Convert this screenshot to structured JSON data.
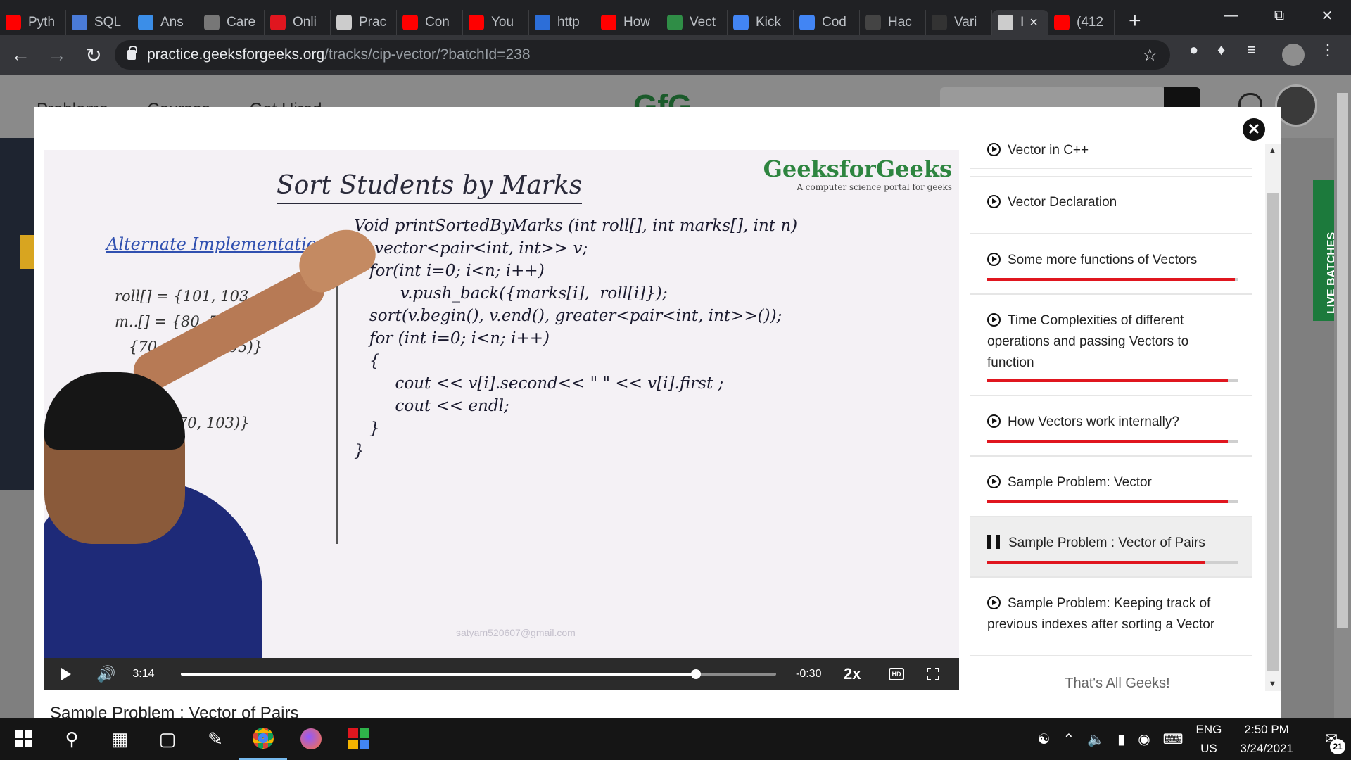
{
  "browser": {
    "tabs": [
      {
        "label": "Pyth",
        "icon": "youtube-icon",
        "color": "#ff0000"
      },
      {
        "label": "SQL",
        "icon": "doc-icon",
        "color": "#4a7bd8"
      },
      {
        "label": "Ans",
        "icon": "brainly-icon",
        "color": "#3b8ee8"
      },
      {
        "label": "Care",
        "icon": "ampersand-icon",
        "color": "#777777"
      },
      {
        "label": "Onli",
        "icon": "u-icon",
        "color": "#e0161f"
      },
      {
        "label": "Prac",
        "icon": "globe-icon",
        "color": "#cccccc"
      },
      {
        "label": "Con",
        "icon": "youtube-icon",
        "color": "#ff0000"
      },
      {
        "label": "You",
        "icon": "youtube-icon",
        "color": "#ff0000"
      },
      {
        "label": "http",
        "icon": "video-icon",
        "color": "#2c6ed8"
      },
      {
        "label": "How",
        "icon": "youtube-icon",
        "color": "#ff0000"
      },
      {
        "label": "Vect",
        "icon": "gfg-icon",
        "color": "#2f8d46"
      },
      {
        "label": "Kick",
        "icon": "google-icon",
        "color": "#4285f4"
      },
      {
        "label": "Cod",
        "icon": "google-icon",
        "color": "#4285f4"
      },
      {
        "label": "Hac",
        "icon": "github-icon",
        "color": "#444444"
      },
      {
        "label": "Vari",
        "icon": "hh-icon",
        "color": "#333333"
      },
      {
        "label": "I",
        "icon": "globe-icon",
        "color": "#cccccc",
        "active": true
      },
      {
        "label": "(412",
        "icon": "youtube-icon",
        "color": "#ff0000"
      }
    ],
    "new_tab": "+",
    "url_host": "practice.geeksforgeeks.org",
    "url_path": "/tracks/cip-vector/?batchId=238"
  },
  "site": {
    "nav": [
      "Problems",
      "Courses",
      "Get Hired"
    ],
    "logo": "GfG",
    "live_batches": "LIVE BATCHES"
  },
  "video": {
    "whiteboard": {
      "title": "Sort Students by Marks",
      "brand": "GeeksforGeeks",
      "brand_tag": "A computer science portal for geeks",
      "alt_heading": "Alternate Implementation",
      "code": "Void printSortedByMarks (int roll[], int marks[], int n)\n{  vector<pair<int, int>> v;\n   for(int i=0; i<n; i++)\n         v.push_back({marks[i],  roll[i]});\n   sort(v.begin(), v.end(), greater<pair<int, int>>());\n   for (int i=0; i<n; i++)\n   {\n        cout << v[i].second<< \" \" << v[i].first ;\n        cout << endl;\n   }\n}",
      "left_notes": "roll[] = {101, 103, ...\nm..[] = {80, 70...\n   {70      (90, 105)}\n\n\n     01), (70, 103)}\n\n      90\n      80",
      "watermark": "satyam520607@gmail.com"
    },
    "controls": {
      "elapsed": "3:14",
      "remaining": "-0:30",
      "speed": "2x",
      "hd": "HD",
      "progress": 0.865
    },
    "title": "Sample Problem : Vector of Pairs"
  },
  "playlist": {
    "items": [
      {
        "label": "Vector in C++",
        "state": "played",
        "progress": 1.0
      },
      {
        "label": "Vector Declaration",
        "state": "played",
        "progress": 0
      },
      {
        "label": "Some more functions of Vectors",
        "state": "played",
        "progress": 0.99
      },
      {
        "label": "Time Complexities of different operations and passing Vectors to function",
        "state": "played",
        "progress": 0.96
      },
      {
        "label": "How Vectors work internally?",
        "state": "played",
        "progress": 0.96
      },
      {
        "label": "Sample Problem: Vector",
        "state": "played",
        "progress": 0.96
      },
      {
        "label": "Sample Problem : Vector of Pairs",
        "state": "playing",
        "progress": 0.87
      },
      {
        "label": "Sample Problem: Keeping track of previous indexes after sorting a Vector",
        "state": "unplayed",
        "progress": 0
      }
    ],
    "end_text": "That's All Geeks!"
  },
  "taskbar": {
    "lang_top": "ENG",
    "lang_bottom": "US",
    "time": "2:50 PM",
    "date": "3/24/2021",
    "notifications": "21"
  }
}
